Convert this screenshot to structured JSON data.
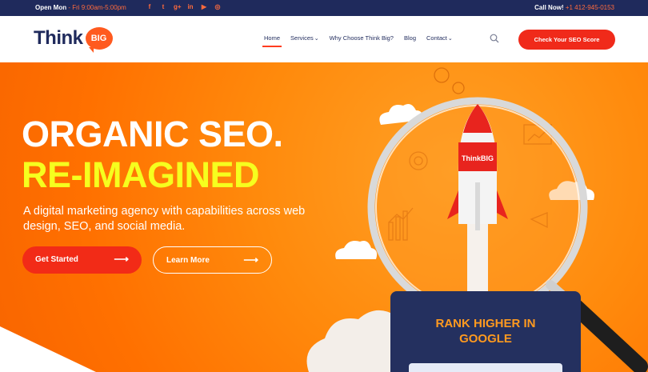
{
  "topbar": {
    "hours_label": "Open Mon",
    "hours_time": " - Fri 9:00am-5:00pm",
    "socials": [
      {
        "name": "facebook-icon",
        "glyph": "f"
      },
      {
        "name": "twitter-icon",
        "glyph": "t"
      },
      {
        "name": "google-plus-icon",
        "glyph": "g+"
      },
      {
        "name": "linkedin-icon",
        "glyph": "in"
      },
      {
        "name": "youtube-icon",
        "glyph": "▶"
      },
      {
        "name": "instagram-icon",
        "glyph": "◎"
      }
    ],
    "call_label": "Call Now!",
    "call_number": " +1 412-945-0153"
  },
  "header": {
    "logo_think": "Think",
    "logo_big": "BIG",
    "nav": [
      {
        "label": "Home",
        "active": true,
        "dropdown": false
      },
      {
        "label": "Services",
        "active": false,
        "dropdown": true
      },
      {
        "label": "Why Choose Think Big?",
        "active": false,
        "dropdown": false
      },
      {
        "label": "Blog",
        "active": false,
        "dropdown": false
      },
      {
        "label": "Contact",
        "active": false,
        "dropdown": true
      }
    ],
    "cta_label": "Check Your SEO Score"
  },
  "hero": {
    "headline_1": "ORGANIC SEO.",
    "headline_2": "RE-IMAGINED",
    "subheadline": "A digital marketing agency with capabilities across web design, SEO, and social media.",
    "primary_button": "Get Started",
    "secondary_button": "Learn More",
    "arrow": "⟶",
    "rocket_text": "ThinkBIG"
  },
  "rank_card": {
    "title_1": "RANK HIGHER IN",
    "title_2": "GOOGLE"
  },
  "colors": {
    "navy": "#1f2a5c",
    "accent_red": "#f02a1a",
    "orange": "#ff7a00",
    "yellow": "#f6ff1e"
  }
}
